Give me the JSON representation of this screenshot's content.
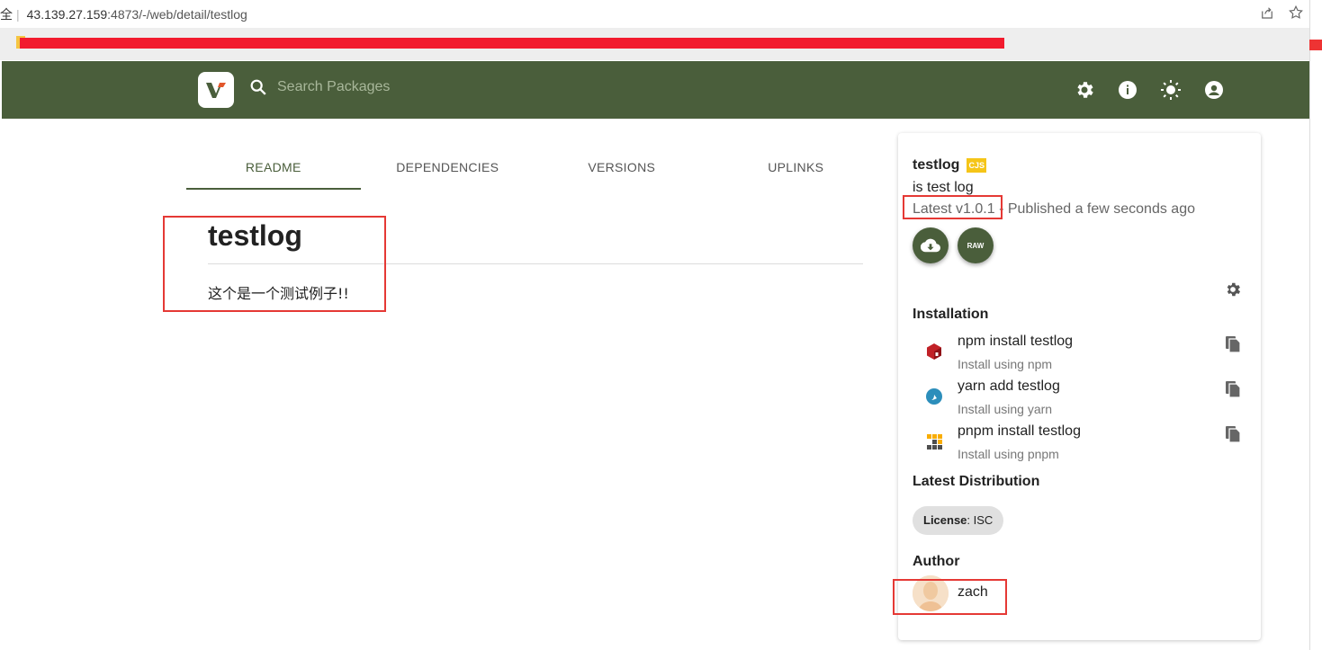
{
  "browser": {
    "security_label": "全",
    "url_host": "43.139.27.159",
    "url_port": ":4873",
    "url_path": "/-/web/detail/testlog"
  },
  "header": {
    "search_placeholder": "Search Packages",
    "brand_color": "#4a5e3b",
    "icons": [
      "settings-icon",
      "info-icon",
      "theme-icon",
      "account-icon"
    ]
  },
  "tabs": [
    {
      "label": "README",
      "active": true
    },
    {
      "label": "DEPENDENCIES",
      "active": false
    },
    {
      "label": "VERSIONS",
      "active": false
    },
    {
      "label": "UPLINKS",
      "active": false
    }
  ],
  "readme": {
    "title": "testlog",
    "body": "这个是一个测试例子!!"
  },
  "sidebar": {
    "name": "testlog",
    "module_badge": "CJS",
    "description": "is test log",
    "latest_version": "Latest v1.0.1",
    "published": " - Published a few seconds ago",
    "raw_label": "RAW",
    "installation_title": "Installation",
    "install": [
      {
        "command": "npm install testlog",
        "sub": "Install using npm",
        "icon": "npm-icon"
      },
      {
        "command": "yarn add testlog",
        "sub": "Install using yarn",
        "icon": "yarn-icon"
      },
      {
        "command": "pnpm install testlog",
        "sub": "Install using pnpm",
        "icon": "pnpm-icon"
      }
    ],
    "distribution_title": "Latest Distribution",
    "license_key": "License",
    "license_value": ": ISC",
    "author_title": "Author",
    "author_name": "zach"
  }
}
